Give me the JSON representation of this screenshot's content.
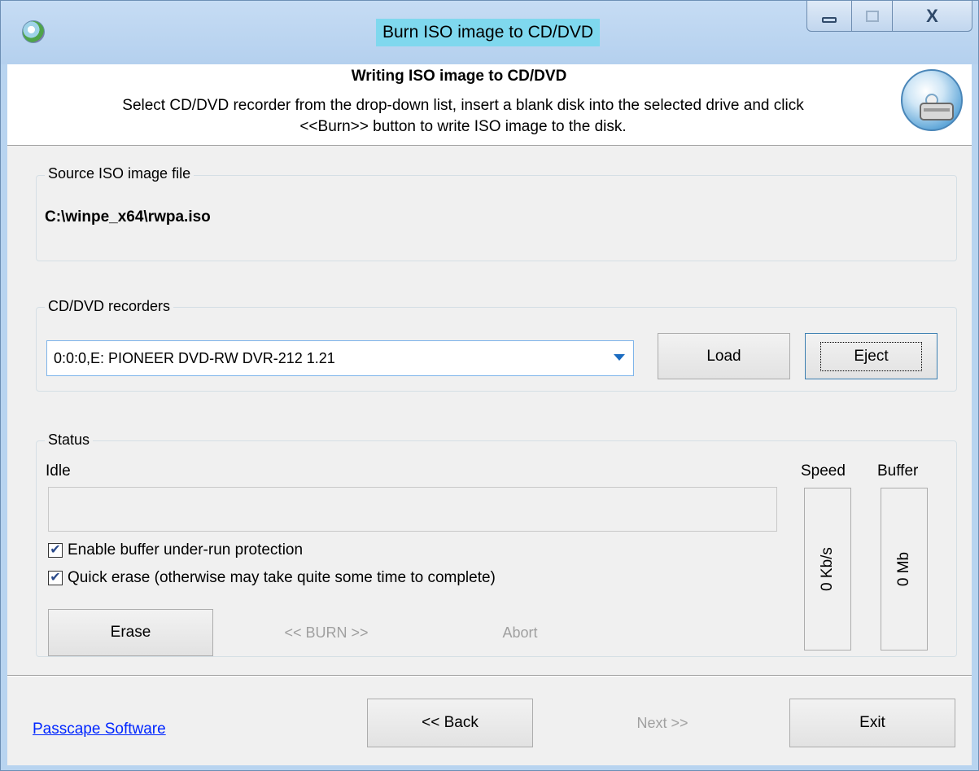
{
  "window": {
    "title": "Burn ISO image to CD/DVD",
    "controls": {
      "minimize": "minimize",
      "maximize": "maximize",
      "close": "X"
    }
  },
  "header": {
    "title": "Writing ISO image to CD/DVD",
    "description_line1": "Select CD/DVD recorder from the drop-down list, insert a blank disk into the selected drive and click",
    "description_line2": "<<Burn>> button to write ISO image to the disk."
  },
  "source": {
    "group_label": "Source ISO image file",
    "path": "C:\\winpe_x64\\rwpa.iso"
  },
  "recorders": {
    "group_label": "CD/DVD recorders",
    "selected": "0:0:0,E: PIONEER  DVD-RW  DVR-212  1.21",
    "load_label": "Load",
    "eject_label": "Eject"
  },
  "status": {
    "group_label": "Status",
    "state": "Idle",
    "speed_label": "Speed",
    "buffer_label": "Buffer",
    "speed_value": "0 Kb/s",
    "buffer_value": "0 Mb",
    "buffer_protection_label": "Enable buffer under-run protection",
    "buffer_protection_checked": true,
    "quick_erase_label": "Quick erase (otherwise may take quite some time to complete)",
    "quick_erase_checked": true,
    "erase_label": "Erase",
    "burn_label": "<< BURN >>",
    "abort_label": "Abort"
  },
  "footer": {
    "link": "Passcape Software",
    "back_label": "<< Back",
    "next_label": "Next >>",
    "exit_label": "Exit"
  },
  "colors": {
    "title_highlight": "#7fd8ee",
    "link": "#0026ff",
    "combo_border": "#7eb4ea",
    "disabled_text": "#a0a0a0"
  }
}
